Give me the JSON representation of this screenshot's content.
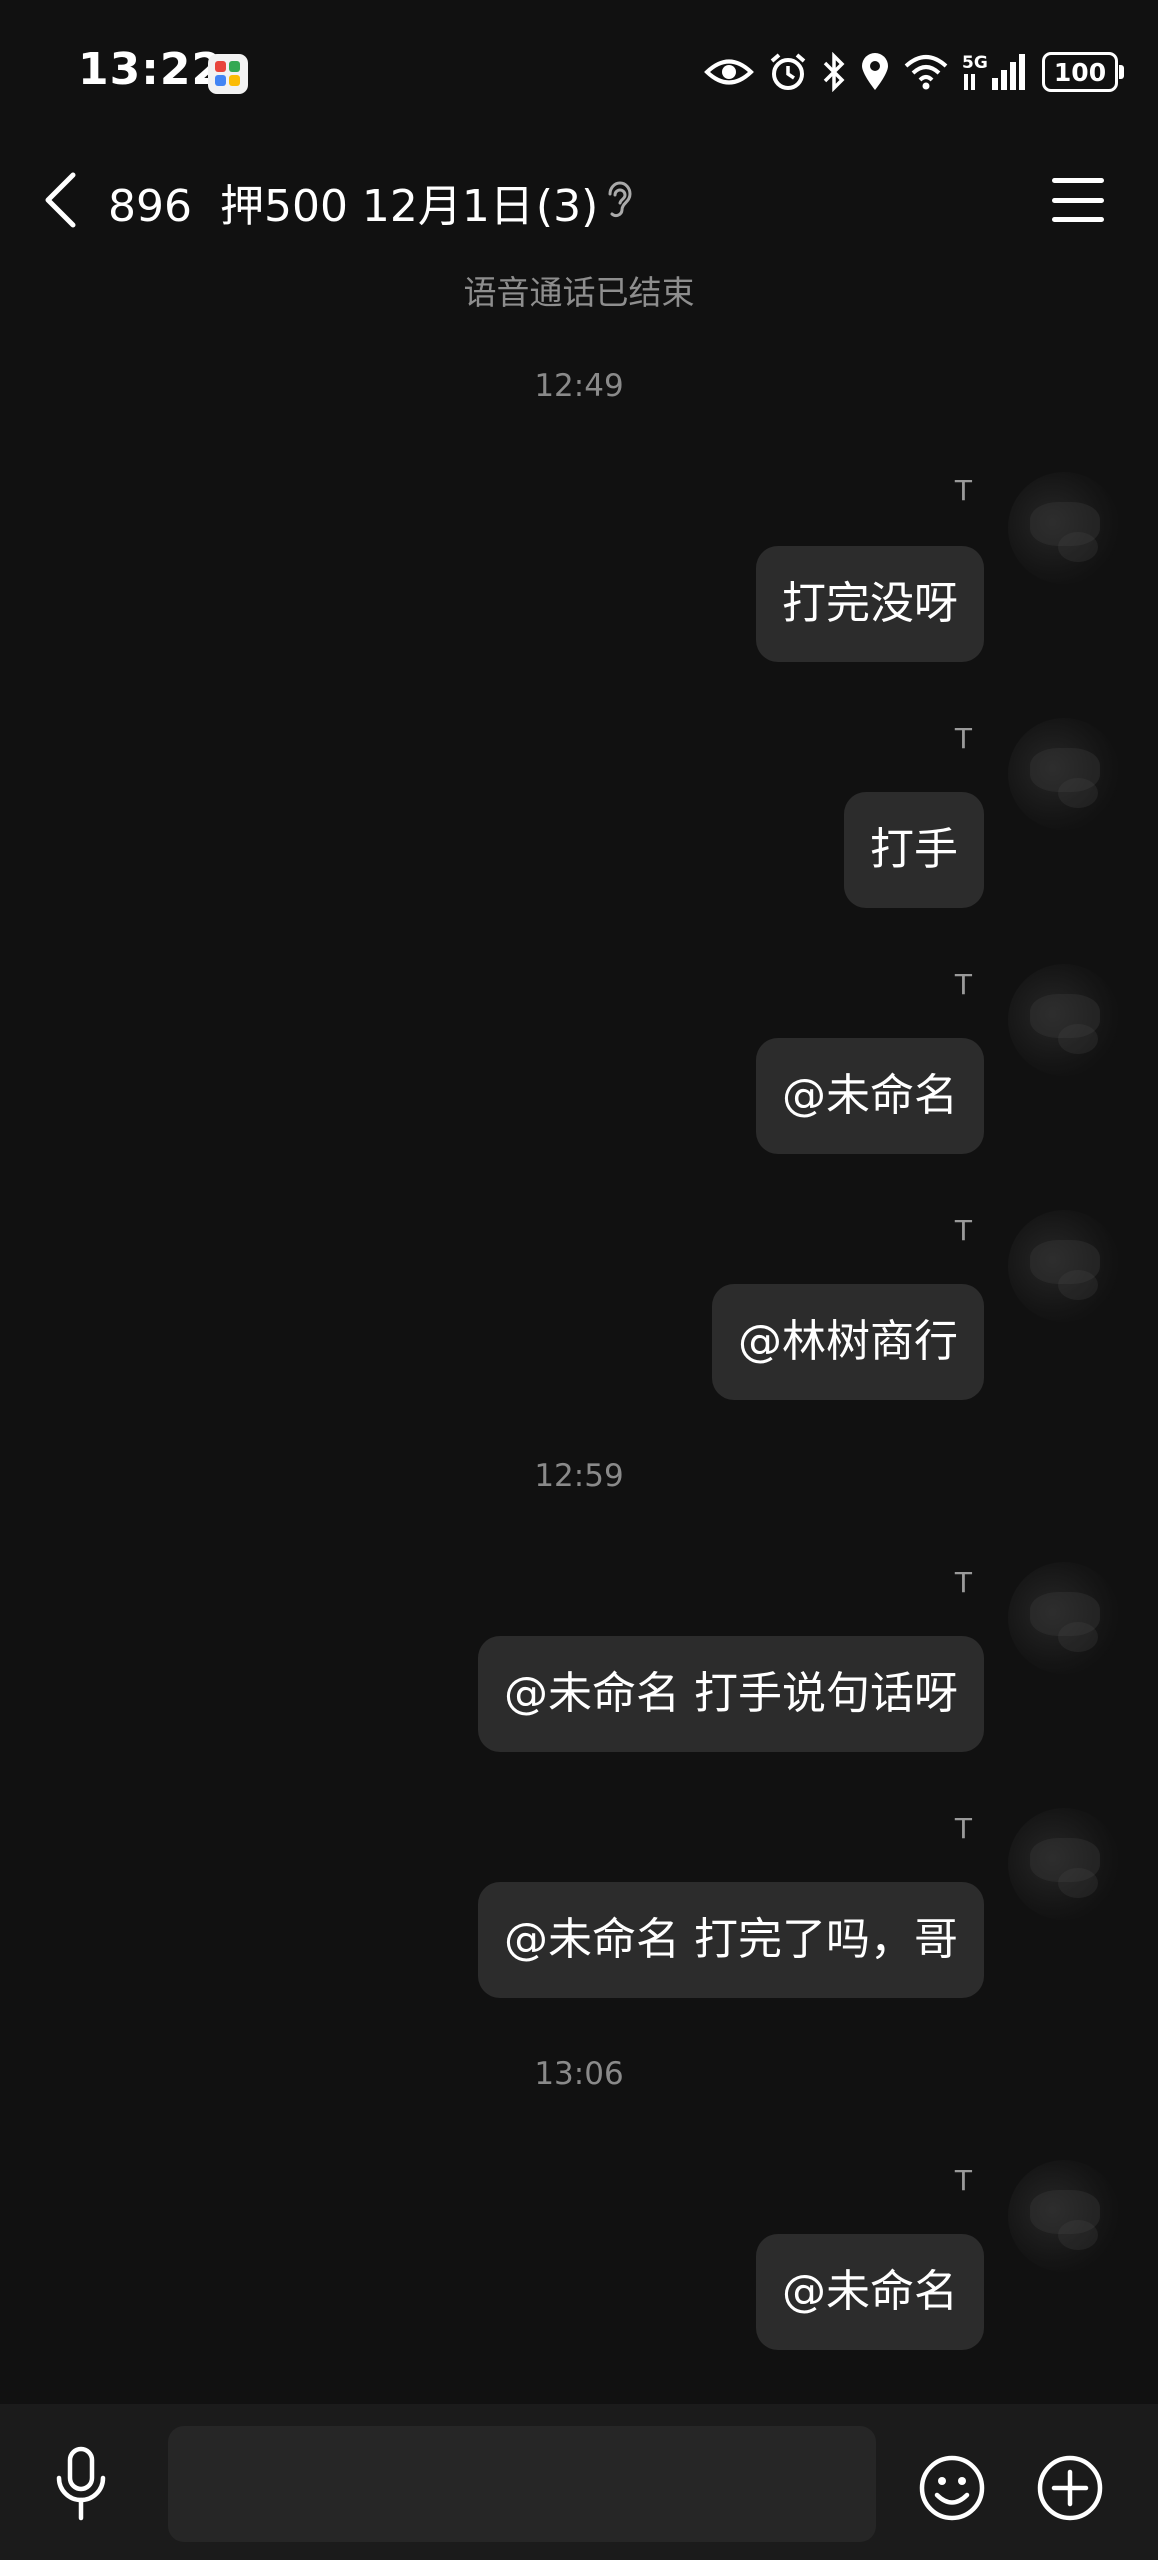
{
  "status_bar": {
    "time": "13:22",
    "network": "5G",
    "battery": "100",
    "icons": [
      "eye-icon",
      "alarm-icon",
      "bluetooth-icon",
      "location-icon",
      "wifi-icon",
      "signal-icon",
      "battery-icon"
    ]
  },
  "header": {
    "title": "896  押500 12月1日",
    "member_count": "(3)",
    "icons": [
      "back-icon",
      "ear-icon",
      "menu-icon"
    ]
  },
  "system_message": "语音通话已结束",
  "messages": [
    {
      "timestamp": "12:49",
      "sender": "T",
      "text": "打完没呀"
    },
    {
      "sender": "T",
      "text": "打手"
    },
    {
      "sender": "T",
      "text": "@未命名"
    },
    {
      "sender": "T",
      "text": "@林树商行"
    },
    {
      "timestamp": "12:59",
      "sender": "T",
      "text": "@未命名 打手说句话呀"
    },
    {
      "sender": "T",
      "text": "@未命名 打完了吗，哥"
    },
    {
      "timestamp": "13:06",
      "sender": "T",
      "text": "@未命名"
    }
  ],
  "input_bar": {
    "icons": [
      "microphone-icon",
      "emoji-icon",
      "plus-icon"
    ],
    "placeholder": ""
  },
  "colors": {
    "background": "#111111",
    "bubble": "#2c2c2c",
    "secondary_text": "#8e8e8e",
    "input_bar": "#1b1b1b"
  }
}
